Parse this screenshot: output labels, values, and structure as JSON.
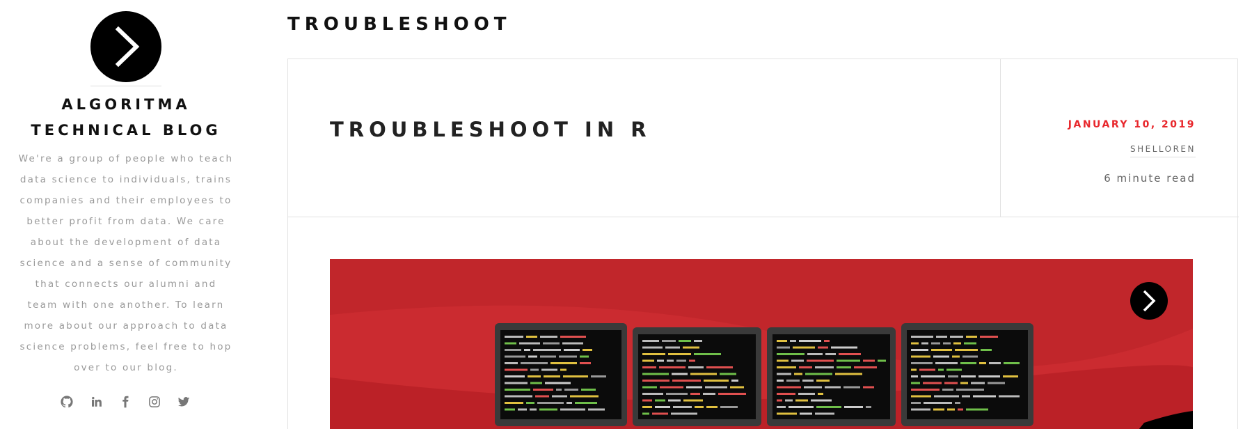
{
  "sidebar": {
    "logo_icon": "chevron-right-icon",
    "site_title_line1": "ALGORITMA",
    "site_title_line2": "TECHNICAL BLOG",
    "description": "We're a group of people who teach data science to individuals, trains companies and their employees to better profit from data. We care about the development of data science and a sense of community that connects our alumni and team with one another. To learn more about our approach to data science problems, feel free to hop over to our blog.",
    "social": [
      "github-icon",
      "linkedin-icon",
      "facebook-icon",
      "instagram-icon",
      "twitter-icon"
    ]
  },
  "main": {
    "page_heading": "TROUBLESHOOT",
    "post": {
      "title": "TROUBLESHOOT IN R",
      "date": "JANUARY 10, 2019",
      "author": "SHELLOREN",
      "read_time": "6 minute read"
    },
    "hero": {
      "background_color": "#c1262b",
      "badge_icon": "chevron-right-icon"
    }
  },
  "colors": {
    "accent": "#e8262b",
    "text_muted": "#999999"
  }
}
